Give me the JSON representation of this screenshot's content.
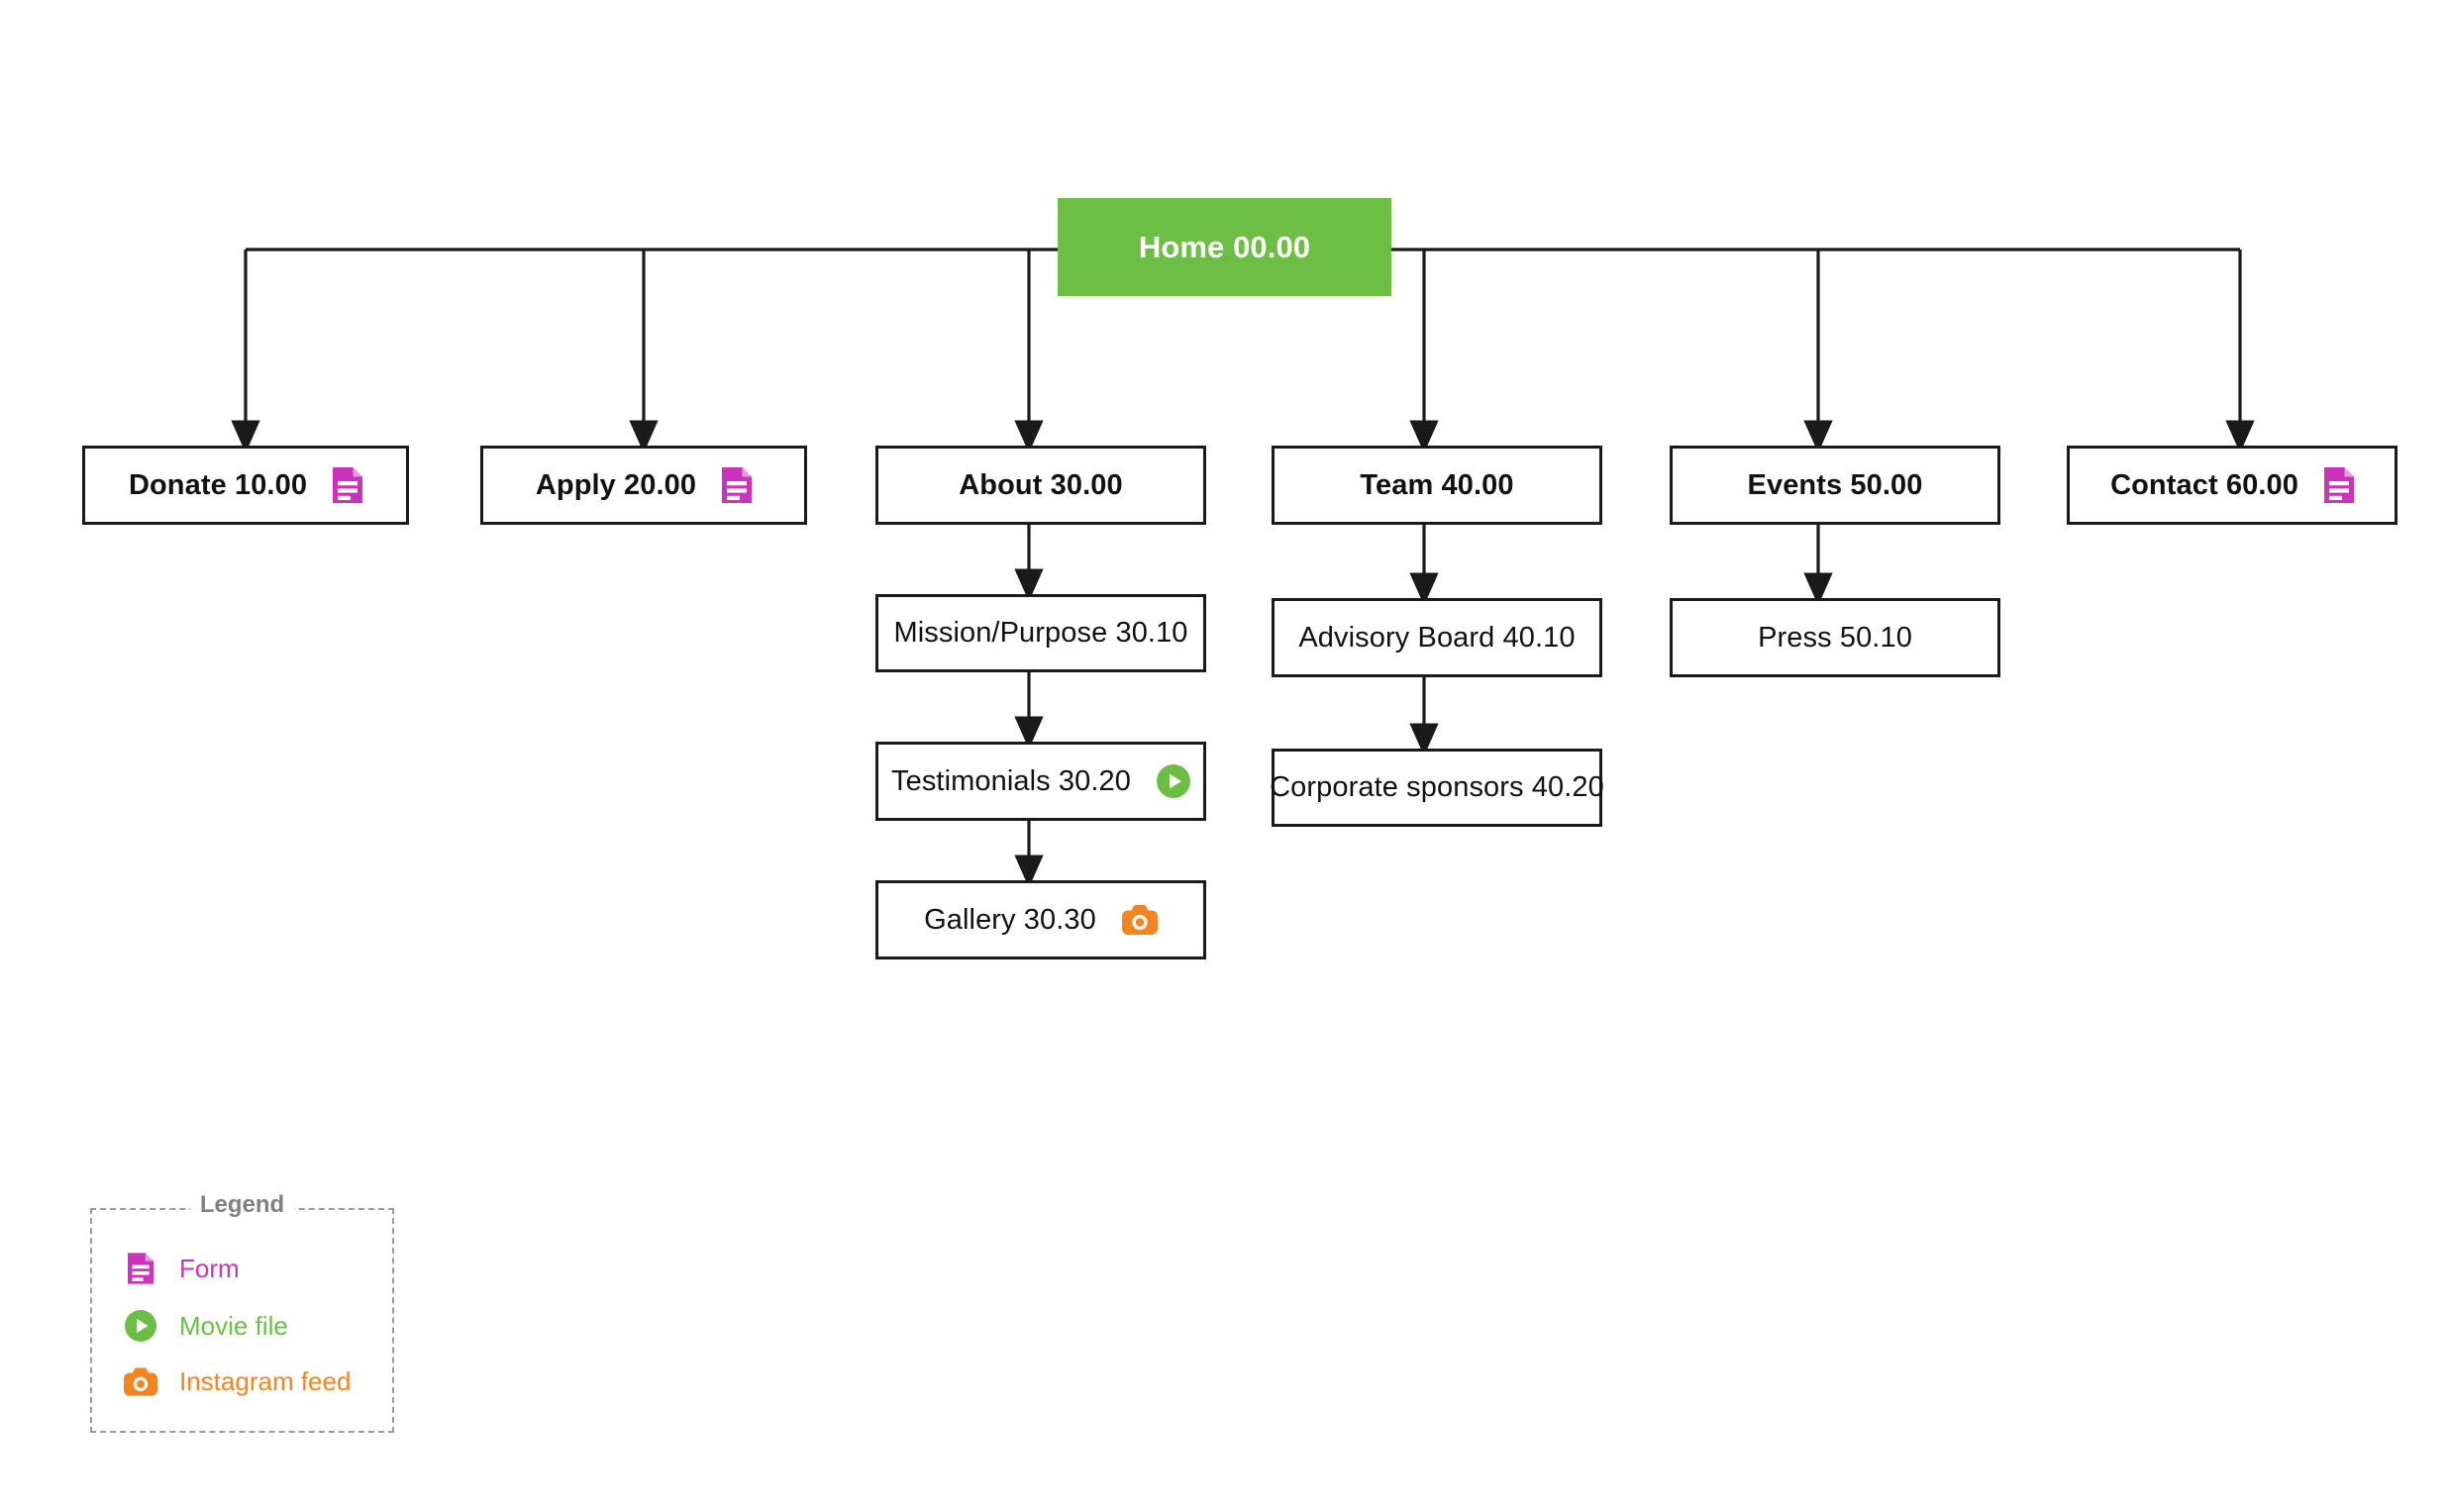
{
  "diagram": {
    "type": "sitemap-tree",
    "root": {
      "id": "home",
      "label": "Home 00.00",
      "fill": "#6CBE45",
      "text_color": "#FFFFFF"
    },
    "branches": [
      {
        "id": "donate",
        "label": "Donate 10.00",
        "icon": "form-icon",
        "children": []
      },
      {
        "id": "apply",
        "label": "Apply 20.00",
        "icon": "form-icon",
        "children": []
      },
      {
        "id": "about",
        "label": "About 30.00",
        "icon": null,
        "children": [
          {
            "id": "mission",
            "label": "Mission/Purpose 30.10",
            "icon": null
          },
          {
            "id": "testimonials",
            "label": "Testimonials 30.20",
            "icon": "movie-icon"
          },
          {
            "id": "gallery",
            "label": "Gallery 30.30",
            "icon": "instagram-icon"
          }
        ]
      },
      {
        "id": "team",
        "label": "Team 40.00",
        "icon": null,
        "children": [
          {
            "id": "advisory-board",
            "label": "Advisory Board 40.10",
            "icon": null
          },
          {
            "id": "corporate-sponsors",
            "label": "Corporate sponsors 40.20",
            "icon": null
          }
        ]
      },
      {
        "id": "events",
        "label": "Events 50.00",
        "icon": null,
        "children": [
          {
            "id": "press",
            "label": "Press 50.10",
            "icon": null
          }
        ]
      },
      {
        "id": "contact",
        "label": "Contact 60.00",
        "icon": "form-icon",
        "children": []
      }
    ]
  },
  "legend": {
    "title": "Legend",
    "items": [
      {
        "icon": "form-icon",
        "label": "Form",
        "color": "#CC33BB"
      },
      {
        "icon": "movie-icon",
        "label": "Movie file",
        "color": "#6CBE45"
      },
      {
        "icon": "instagram-icon",
        "label": "Instagram feed",
        "color": "#F28522"
      }
    ]
  },
  "colors": {
    "accent_green": "#6CBE45",
    "form_magenta": "#CC33BB",
    "instagram_orange": "#F28522",
    "node_border": "#1A1A1A",
    "legend_border": "#9B9B9B",
    "legend_title": "#808080",
    "connector": "#1A1A1A"
  }
}
